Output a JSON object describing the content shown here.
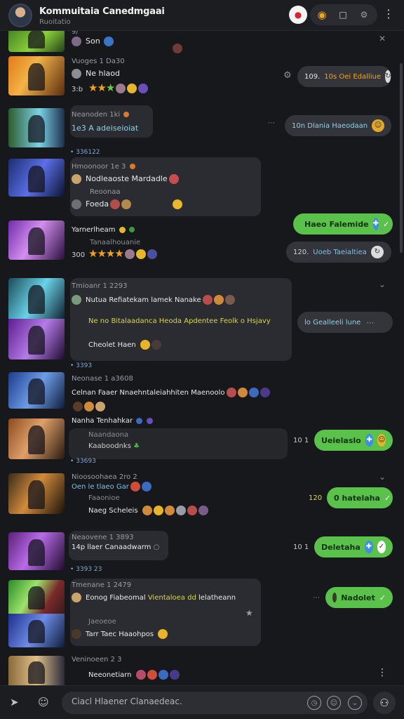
{
  "header": {
    "title": "Kommuitaia Canedmgaai",
    "subtitle": "Ruoitatio"
  },
  "feed": [
    {
      "meta": "9/",
      "name": "Son"
    },
    {
      "meta": "Vuoges 1 Da30",
      "name": "Ne hlaod",
      "rating_text": "3:b",
      "pill": "10s  Oei Edalliue",
      "pill_count": "109."
    },
    {
      "meta": "Neanoden 1ki",
      "name": "1e3 A adeiseioiat",
      "time": "• 336122",
      "pill": "10n  Dlania Haeodaan",
      "pill_count": "10n"
    },
    {
      "meta": "Hmoonoor 1e 3",
      "name": "Nodleaoste Mardadle",
      "line2": "Reoonaa",
      "line3": "Foeda",
      "pill": "Haeo Falemide"
    },
    {
      "meta": "Yarnerlheam",
      "name": "Tanaalhouanie",
      "rating_text": "300",
      "pill": "Uoeb Taeialtiea",
      "pill_count": "120."
    },
    {
      "meta": "Tmioanr 1 2293",
      "name": "Nutua Refiatekam lamek Nanake",
      "line2": "Ne no Bitalaadanca Heoda Apdentee Feolk o Hsjavy",
      "line3": "Cheolet Haen",
      "pill": "lo Gealleeli lune"
    },
    {
      "meta": "Neonase 1 a3608",
      "name": "Celnan Faaer Nnaehntaleiahhiten Maenoolo",
      "time": "• 3393"
    },
    {
      "meta": "Nanha Tenhahkar",
      "name": "Naandaona",
      "line2": "Kaaboodnks",
      "time": "• 33693",
      "pill": "Ueielaslo",
      "pill_count": "10 1"
    },
    {
      "meta": "Nioosoohaea 2ro 2",
      "name": "Oen le tlaeo Gar",
      "line2": "Faaonioe",
      "line3": "Naeg Scheleis",
      "pill": "0 hatelaha",
      "pill_count": "120"
    },
    {
      "meta": "Neaovene 1 3893",
      "name": "14p llaer Canaadwarm",
      "time": "• 3393 23",
      "pill": "Deletaha",
      "pill_count": "10 1"
    },
    {
      "meta": "Tmenane 1 2479",
      "name": "Eonog Fiabeomal",
      "name_highlight": "Vientaloea dd",
      "name_tail": "lelatheann",
      "line2": "Jaeoeoe",
      "line3": "Tarr Taec Haaohpos",
      "pill": "Nadolet"
    },
    {
      "meta": "Veninoeen 2 3",
      "name": "Neeonetiarn"
    }
  ],
  "composer": {
    "placeholder": "Ciacl Hlaener Clanaedeac."
  },
  "colors": {
    "background": "#17181b",
    "bubble": "#2b2c31",
    "pill_green": "#5ac24a",
    "star": "#f2a21b"
  }
}
